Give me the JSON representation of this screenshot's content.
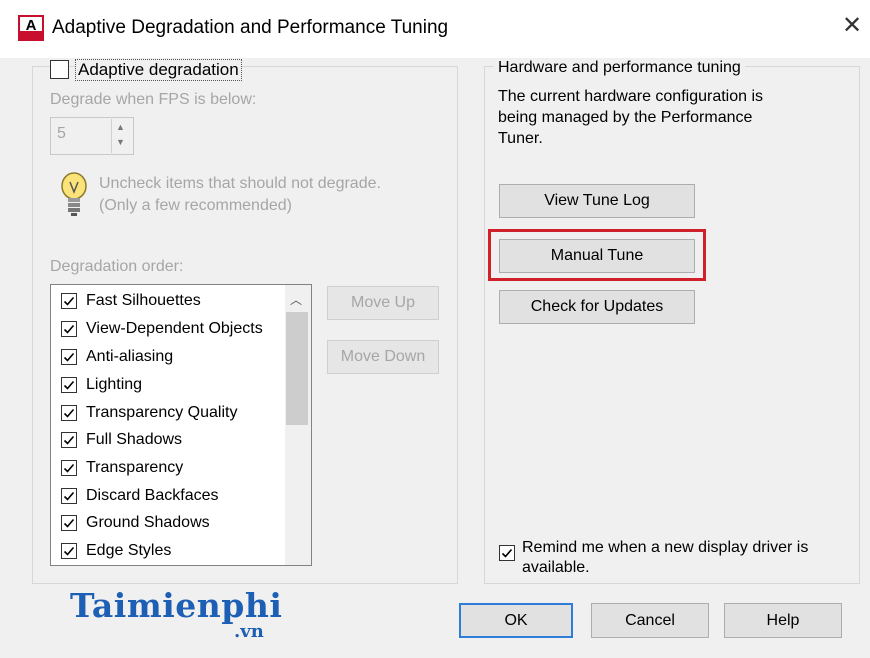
{
  "window": {
    "title": "Adaptive Degradation and Performance Tuning",
    "close_glyph": "✕",
    "app_icon": "autocad-icon"
  },
  "left": {
    "adaptive_label": "Adaptive degradation",
    "adaptive_checked": false,
    "fps_label": "Degrade when FPS is below:",
    "fps_value": "5",
    "hint_line1": "Uncheck items that should not degrade.",
    "hint_line2": "(Only a few recommended)",
    "order_label": "Degradation order:",
    "items": [
      {
        "label": "Fast Silhouettes",
        "checked": true
      },
      {
        "label": "View-Dependent Objects",
        "checked": true
      },
      {
        "label": "Anti-aliasing",
        "checked": true
      },
      {
        "label": "Lighting",
        "checked": true
      },
      {
        "label": "Transparency Quality",
        "checked": true
      },
      {
        "label": "Full Shadows",
        "checked": true
      },
      {
        "label": "Transparency",
        "checked": true
      },
      {
        "label": "Discard Backfaces",
        "checked": true
      },
      {
        "label": "Ground Shadows",
        "checked": true
      },
      {
        "label": "Edge Styles",
        "checked": true
      }
    ],
    "move_up": "Move Up",
    "move_down": "Move Down"
  },
  "right": {
    "group_title": "Hardware and performance tuning",
    "description": "The current hardware configuration is being managed by the Performance Tuner.",
    "view_log": "View Tune Log",
    "manual_tune": "Manual Tune",
    "check_updates": "Check for Updates",
    "remind_label": "Remind me when a new display driver is available.",
    "remind_checked": true
  },
  "footer": {
    "logo_text": "Taimienphi",
    "logo_suffix": ".vn",
    "ok": "OK",
    "cancel": "Cancel",
    "help": "Help"
  },
  "colors": {
    "highlight": "#d0202a",
    "logo": "#1c5fb4",
    "accent": "#2e7dd7"
  }
}
